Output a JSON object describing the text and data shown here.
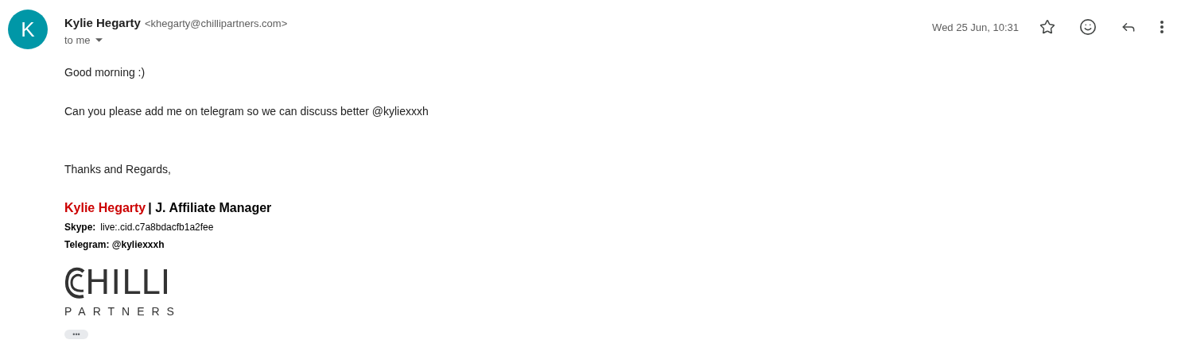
{
  "sender": {
    "avatar_letter": "K",
    "name": "Kylie Hegarty",
    "email": "<khegarty@chillipartners.com>",
    "recipient": "to me"
  },
  "date": "Wed 25 Jun, 10:31",
  "body": [
    "Good morning :)",
    "Can you please add me on telegram so we can discuss better @kyliexxxh"
  ],
  "closing": "Thanks and Regards,",
  "signature": {
    "name": "Kylie Hegarty",
    "title": "| J. Affiliate Manager",
    "skype_label": "Skype:",
    "skype_value": "live:.cid.c7a8bdacfb1a2fee",
    "telegram": "Telegram: @kyliexxxh"
  },
  "logo": {
    "word": "HILLI",
    "subword": "PARTNERS"
  },
  "more_label": "•••"
}
